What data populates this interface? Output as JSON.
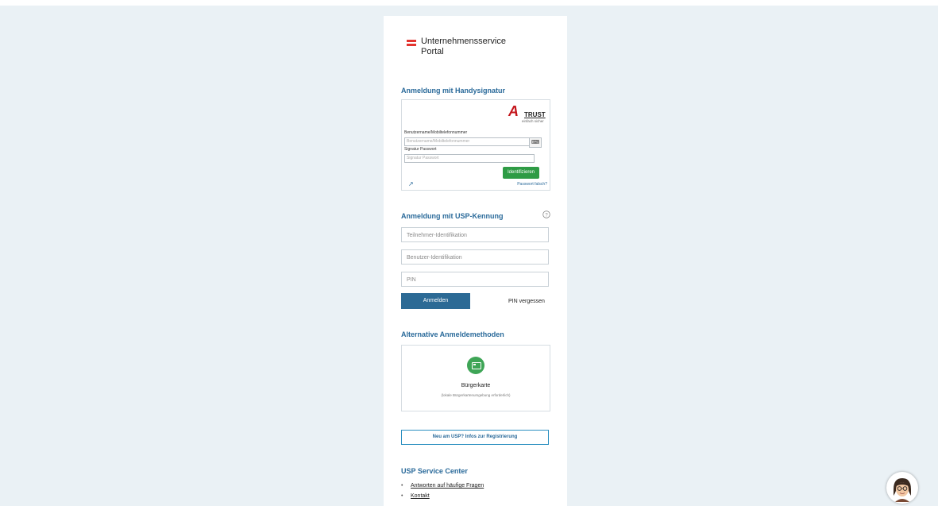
{
  "logo": {
    "line1": "Unternehmensservice",
    "line2": "Portal"
  },
  "handysignatur": {
    "title": "Anmeldung mit Handysignatur",
    "brand": {
      "mark": "A",
      "name": "TRUST",
      "tagline": "einfach sicher"
    },
    "username_label": "Benutzername/Mobiltelefonnummer",
    "username_placeholder": "Benutzername/Mobiltelefonnummer",
    "password_label": "Signatur Passwort",
    "password_placeholder": "Signatur Passwort",
    "identify_label": "Identifizieren",
    "password_wrong_link": "Passwort falsch?"
  },
  "usp": {
    "title": "Anmeldung mit USP-Kennung",
    "help_icon": "?",
    "participant_placeholder": "Teilnehmer-Identifikation",
    "user_placeholder": "Benutzer-Identifikation",
    "pin_placeholder": "PIN",
    "login_label": "Anmelden",
    "pin_forgot_link": "PIN vergessen"
  },
  "alternative": {
    "title": "Alternative Anmeldemethoden",
    "card_title": "Bürgerkarte",
    "card_subtitle": "(lokale Bürgerkartenumgebung erforderlich)"
  },
  "register_label": "Neu am USP? Infos zur Registrierung",
  "service_center": {
    "title": "USP Service Center",
    "links": [
      "Antworten auf häufige Fragen",
      "Kontakt"
    ]
  },
  "colors": {
    "accent": "#2a6a9a",
    "button": "#2c6a95",
    "green": "#2e9b45",
    "background": "#eaf1f5"
  }
}
